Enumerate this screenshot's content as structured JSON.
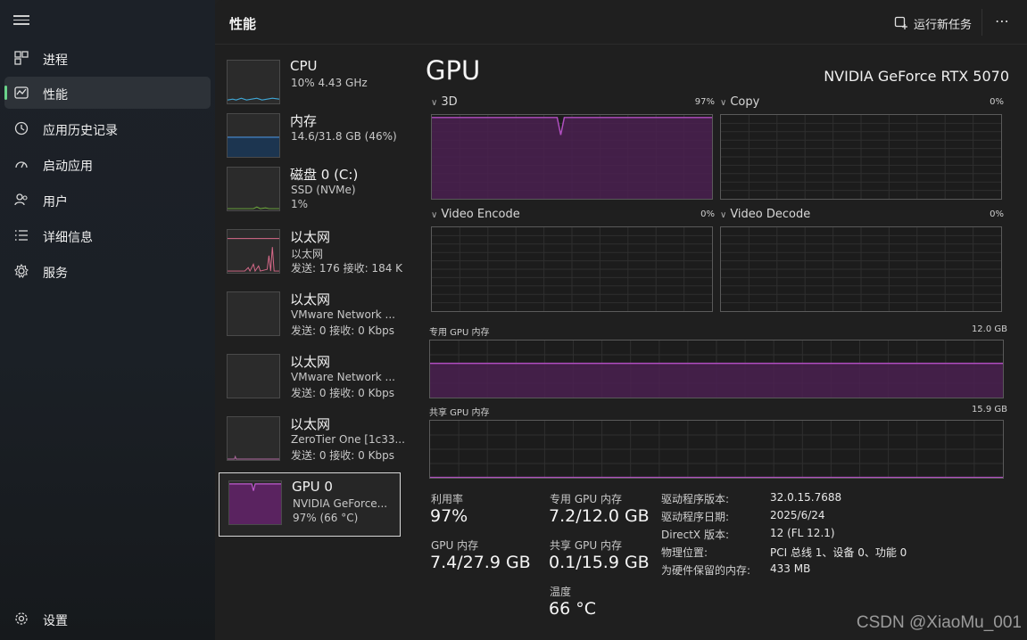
{
  "nav": {
    "items": [
      {
        "label": "进程",
        "icon": "processes-icon"
      },
      {
        "label": "性能",
        "icon": "performance-icon"
      },
      {
        "label": "应用历史记录",
        "icon": "history-icon"
      },
      {
        "label": "启动应用",
        "icon": "startup-icon"
      },
      {
        "label": "用户",
        "icon": "users-icon"
      },
      {
        "label": "详细信息",
        "icon": "details-icon"
      },
      {
        "label": "服务",
        "icon": "services-icon"
      }
    ],
    "settings_label": "设置",
    "accent_color": "#6ad48a"
  },
  "header": {
    "title": "性能",
    "run_task_label": "运行新任务",
    "more_label": "⋯"
  },
  "resources": [
    {
      "name": "CPU",
      "sub1": "10% 4.43 GHz",
      "sub2": ""
    },
    {
      "name": "内存",
      "sub1": "14.6/31.8 GB (46%)",
      "sub2": ""
    },
    {
      "name": "磁盘 0 (C:)",
      "sub1": "SSD (NVMe)",
      "sub2": "1%"
    },
    {
      "name": "以太网",
      "sub1": "以太网",
      "sub2": "发送: 176 接收: 184 Kl"
    },
    {
      "name": "以太网",
      "sub1": "VMware Network ...",
      "sub2": "发送: 0 接收: 0 Kbps"
    },
    {
      "name": "以太网",
      "sub1": "VMware Network ...",
      "sub2": "发送: 0 接收: 0 Kbps"
    },
    {
      "name": "以太网",
      "sub1": "ZeroTier One [1c33...",
      "sub2": "发送: 0 接收: 0 Kbps"
    },
    {
      "name": "GPU 0",
      "sub1": "NVIDIA GeForce...",
      "sub2": "97% (66 °C)"
    }
  ],
  "detail": {
    "title": "GPU",
    "model": "NVIDIA GeForce RTX 5070",
    "engines": [
      {
        "label": "3D",
        "percent": "97%"
      },
      {
        "label": "Copy",
        "percent": "0%"
      },
      {
        "label": "Video Encode",
        "percent": "0%"
      },
      {
        "label": "Video Decode",
        "percent": "0%"
      }
    ],
    "dedicated_label": "专用 GPU 内存",
    "dedicated_max": "12.0 GB",
    "shared_label": "共享 GPU 内存",
    "shared_max": "15.9 GB",
    "stats": {
      "utilization_label": "利用率",
      "utilization_value": "97%",
      "dedicated_label": "专用 GPU 内存",
      "dedicated_value": "7.2/12.0 GB",
      "gpu_mem_label": "GPU 内存",
      "gpu_mem_value": "7.4/27.9 GB",
      "shared_label": "共享 GPU 内存",
      "shared_value": "0.1/15.9 GB",
      "temp_label": "温度",
      "temp_value": "66 °C"
    },
    "info": [
      {
        "key": "驱动程序版本:",
        "value": "32.0.15.7688"
      },
      {
        "key": "驱动程序日期:",
        "value": "2025/6/24"
      },
      {
        "key": "DirectX 版本:",
        "value": "12 (FL 12.1)"
      },
      {
        "key": "物理位置:",
        "value": "PCI 总线 1、设备 0、功能 0"
      },
      {
        "key": "为硬件保留的内存:",
        "value": "433 MB"
      }
    ],
    "levels": {
      "threed_fraction": 0.97,
      "dedicated_fraction": 0.6,
      "shared_fraction": 0.006
    },
    "graph_color": "#b04ec0",
    "graph_fill": "#4a2050"
  },
  "watermark": "CSDN @XiaoMu_001"
}
